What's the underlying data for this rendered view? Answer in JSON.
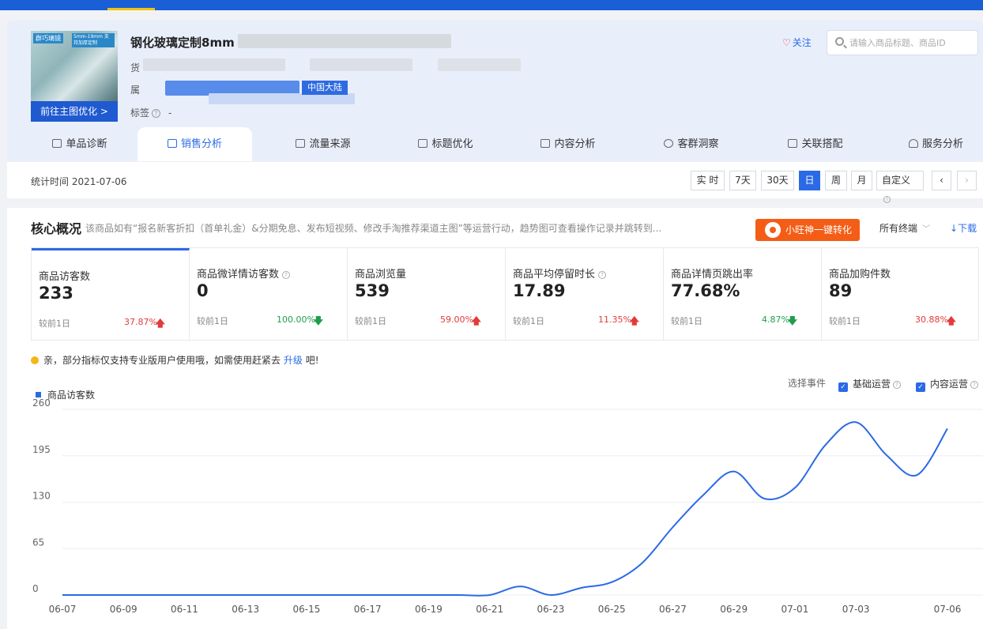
{
  "product": {
    "title": "钢化玻璃定制8mm",
    "thumb_brand": "群巧璃镜",
    "thumb_sub": "5mm-19mm 支持加厚定制",
    "thumb_button": "前往主图优化 >",
    "meta_label_1": "货",
    "meta_label_2": "属",
    "region": "中国大陆",
    "tag_label": "标签",
    "tag_value": "-",
    "follow_label": "关注",
    "search_placeholder": "请输入商品标题、商品ID"
  },
  "tabs": [
    {
      "label": "单品诊断",
      "icon": "bag-icon"
    },
    {
      "label": "销售分析",
      "icon": "bag-icon"
    },
    {
      "label": "流量来源",
      "icon": "line-chart-icon"
    },
    {
      "label": "标题优化",
      "icon": "line-chart-icon"
    },
    {
      "label": "内容分析",
      "icon": "document-icon"
    },
    {
      "label": "客群洞察",
      "icon": "people-icon"
    },
    {
      "label": "关联搭配",
      "icon": "link-icon"
    },
    {
      "label": "服务分析",
      "icon": "headset-icon"
    }
  ],
  "datebar": {
    "stat_time": "统计时间 2021-07-06",
    "buttons": [
      "实 时",
      "7天",
      "30天",
      "日",
      "周",
      "月",
      "自定义"
    ],
    "active": "日",
    "prev_icon": "chevron-left-icon",
    "next_icon": "chevron-right-icon"
  },
  "core": {
    "title": "核心概况",
    "desc": "该商品如有“报名新客折扣（首单礼金）&分期免息、发布短视频、修改手淘推荐渠道主图”等运营行动，趋势图可查看操作记录并跳转到...",
    "ww_button": "小旺神一键转化",
    "terminal": "所有终端",
    "download": "下载"
  },
  "cards": [
    {
      "label": "商品访客数",
      "value": "233",
      "compare": "较前1日",
      "pct": "37.87%",
      "dir": "up",
      "help": false
    },
    {
      "label": "商品微详情访客数",
      "value": "0",
      "compare": "较前1日",
      "pct": "100.00%",
      "dir": "down",
      "help": true
    },
    {
      "label": "商品浏览量",
      "value": "539",
      "compare": "较前1日",
      "pct": "59.00%",
      "dir": "up",
      "help": false
    },
    {
      "label": "商品平均停留时长",
      "value": "17.89",
      "compare": "较前1日",
      "pct": "11.35%",
      "dir": "up",
      "help": true
    },
    {
      "label": "商品详情页跳出率",
      "value": "77.68%",
      "compare": "较前1日",
      "pct": "4.87%",
      "dir": "down",
      "help": false
    },
    {
      "label": "商品加购件数",
      "value": "89",
      "compare": "较前1日",
      "pct": "30.88%",
      "dir": "up",
      "help": false
    }
  ],
  "notice": {
    "text": "亲，部分指标仅支持专业版用户使用哦，如需使用赶紧去",
    "link": "升级",
    "tail": "吧!"
  },
  "events": {
    "label": "选择事件",
    "options": [
      "基础运营",
      "内容运营"
    ]
  },
  "colors": {
    "accent": "#2a6ae6",
    "up": "#e23b3b",
    "down": "#1f9d4b",
    "ww": "#f45d16"
  },
  "chart_data": {
    "type": "line",
    "legend": "商品访客数",
    "ylim": [
      0,
      260
    ],
    "yticks": [
      0,
      65,
      130,
      195,
      260
    ],
    "x": [
      "06-07",
      "06-08",
      "06-09",
      "06-10",
      "06-11",
      "06-12",
      "06-13",
      "06-14",
      "06-15",
      "06-16",
      "06-17",
      "06-18",
      "06-19",
      "06-20",
      "06-21",
      "06-22",
      "06-23",
      "06-24",
      "06-25",
      "06-26",
      "06-27",
      "06-28",
      "06-29",
      "06-30",
      "07-01",
      "07-02",
      "07-03",
      "07-04",
      "07-05",
      "07-06"
    ],
    "xlabels": [
      "06-07",
      "06-09",
      "06-11",
      "06-13",
      "06-15",
      "06-17",
      "06-19",
      "06-21",
      "06-23",
      "06-25",
      "06-27",
      "06-29",
      "07-01",
      "07-03",
      "07-06"
    ],
    "series": [
      {
        "name": "商品访客数",
        "values": [
          0,
          0,
          0,
          0,
          0,
          0,
          0,
          0,
          0,
          0,
          0,
          0,
          0,
          0,
          0,
          12,
          0,
          10,
          18,
          45,
          95,
          140,
          173,
          135,
          150,
          210,
          242,
          196,
          168,
          233
        ]
      }
    ]
  }
}
